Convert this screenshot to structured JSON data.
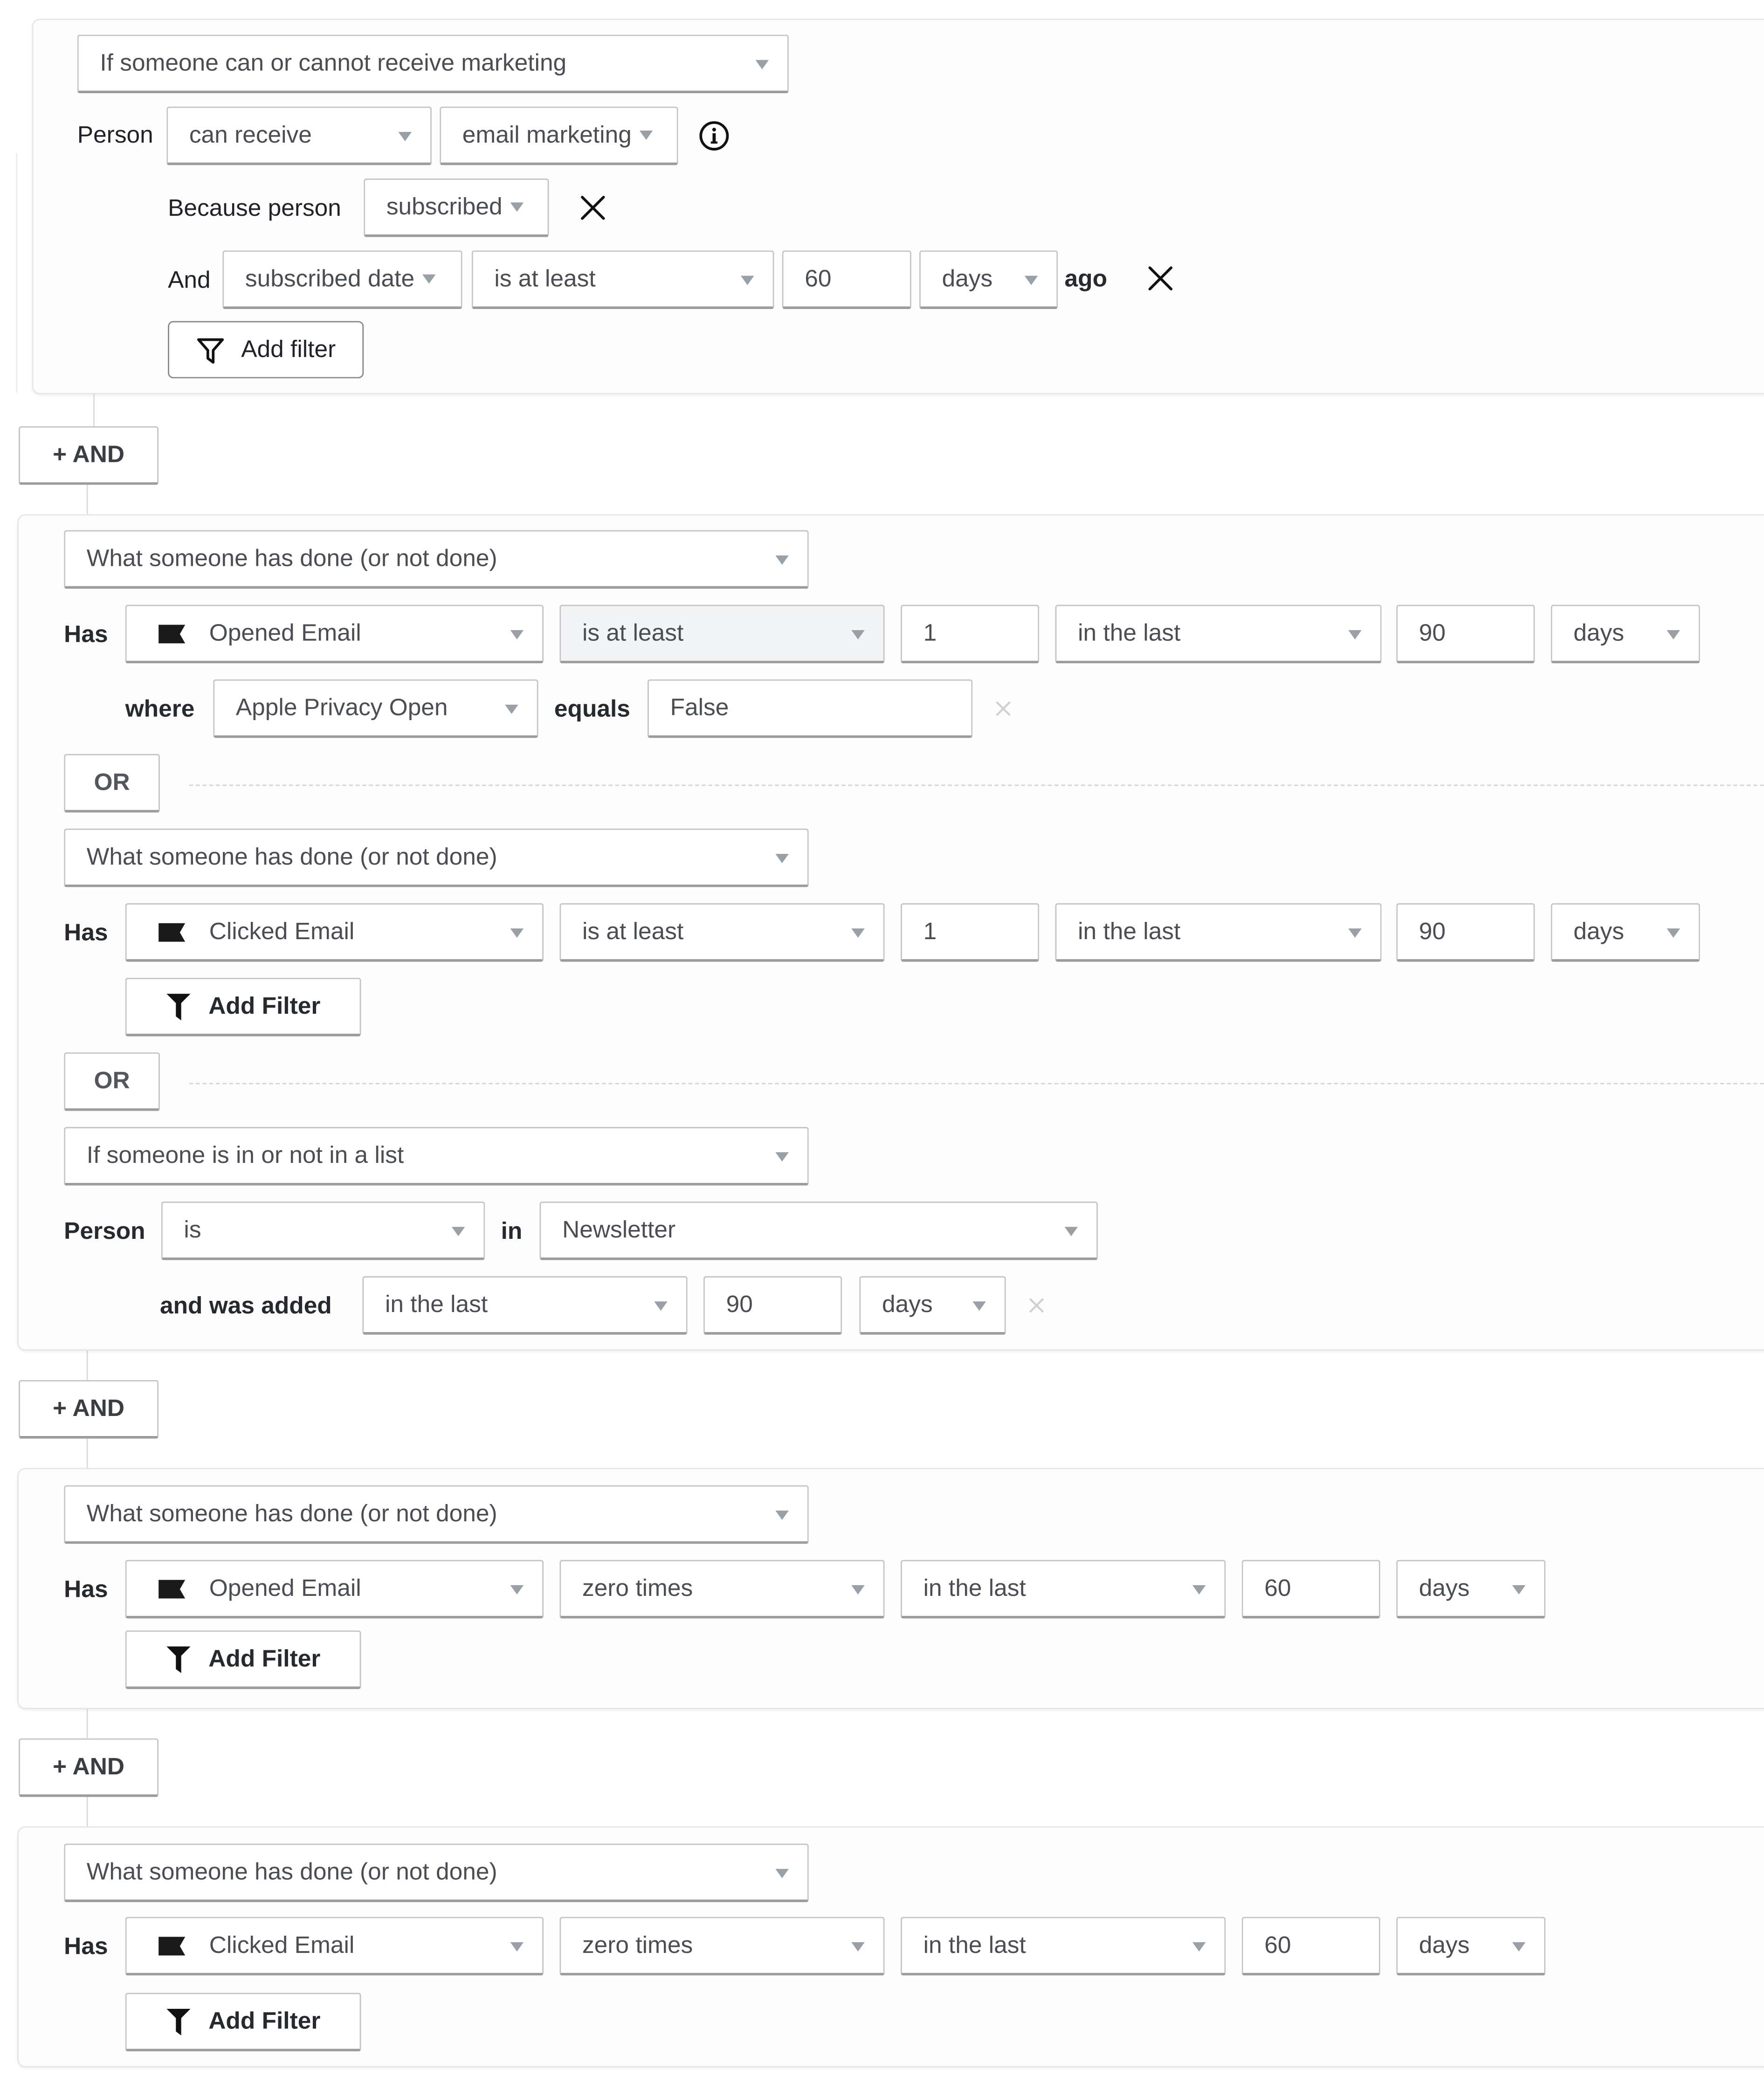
{
  "block1": {
    "condition_type": "If someone can or cannot receive marketing",
    "person_label": "Person",
    "receive_mode": "can receive",
    "channel": "email marketing",
    "info_icon": "info-circle-icon",
    "because_label": "Because person",
    "because_value": "subscribed",
    "and_label": "And",
    "date_field": "subscribed date",
    "comparator": "is at least",
    "amount": "60",
    "unit": "days",
    "ago_label": "ago",
    "add_filter_label": "Add filter"
  },
  "and_button_label": "+ AND",
  "block2": {
    "groups": [
      {
        "condition_type": "What someone has done (or not done)",
        "has_label": "Has",
        "metric": "Opened Email",
        "metric_icon": "flag-icon",
        "frequency": "is at least",
        "count": "1",
        "timeframe": "in the last",
        "period": "90",
        "unit": "days",
        "where_label": "where",
        "where_property": "Apple Privacy Open",
        "equals_label": "equals",
        "where_value": "False"
      },
      {
        "condition_type": "What someone has done (or not done)",
        "has_label": "Has",
        "metric": "Clicked Email",
        "metric_icon": "flag-icon",
        "frequency": "is at least",
        "count": "1",
        "timeframe": "in the last",
        "period": "90",
        "unit": "days",
        "add_filter_label": "Add Filter"
      },
      {
        "condition_type": "If someone is in or not in a list",
        "person_label": "Person",
        "membership": "is",
        "in_label": "in",
        "list_name": "Newsletter",
        "added_label": "and was added",
        "timeframe": "in the last",
        "period": "90",
        "unit": "days"
      }
    ],
    "or_label": "OR"
  },
  "block3": {
    "condition_type": "What someone has done (or not done)",
    "has_label": "Has",
    "metric": "Opened Email",
    "frequency": "zero times",
    "timeframe": "in the last",
    "period": "60",
    "unit": "days",
    "add_filter_label": "Add Filter"
  },
  "block4": {
    "condition_type": "What someone has done (or not done)",
    "has_label": "Has",
    "metric": "Clicked Email",
    "frequency": "zero times",
    "timeframe": "in the last",
    "period": "60",
    "unit": "days",
    "add_filter_label": "Add Filter"
  },
  "colors": {
    "text_primary": "#26292d",
    "text_field": "#4a4d52",
    "border": "#c4c4c4",
    "caret": "#9aa0a8",
    "focused_field_bg": "#f3f4f6"
  }
}
